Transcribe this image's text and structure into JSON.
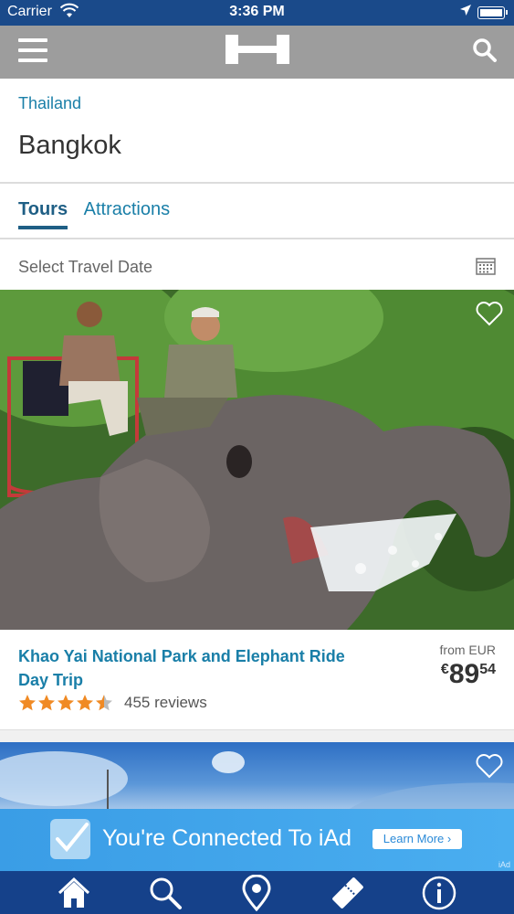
{
  "status_bar": {
    "carrier": "Carrier",
    "time": "3:36 PM"
  },
  "nav": {
    "menu_icon": "hamburger-icon",
    "logo_icon": "hotel-logo-icon",
    "search_icon": "search-icon"
  },
  "header": {
    "breadcrumb": "Thailand",
    "title": "Bangkok"
  },
  "tabs": [
    {
      "label": "Tours",
      "active": true
    },
    {
      "label": "Attractions",
      "active": false
    }
  ],
  "date_filter": {
    "label": "Select Travel Date",
    "icon": "calendar-icon"
  },
  "tours": [
    {
      "title": "Khao Yai National Park and Elephant Ride Day Trip",
      "from_label": "from EUR",
      "currency_symbol": "€",
      "price_whole": "89",
      "price_cents": "54",
      "rating": 4.5,
      "reviews": "455 reviews"
    }
  ],
  "ad": {
    "text": "You're Connected To iAd",
    "button": "Learn More ›",
    "tag": "iAd"
  },
  "bottom_tabs": [
    {
      "icon": "home-icon"
    },
    {
      "icon": "search-icon"
    },
    {
      "icon": "map-pin-icon"
    },
    {
      "icon": "ticket-icon"
    },
    {
      "icon": "info-icon"
    }
  ],
  "colors": {
    "status_bar": "#1a4a8a",
    "nav_bar": "#9d9d9d",
    "link": "#1a7fa8",
    "star": "#f08a24",
    "tab_bar": "#15418a",
    "ad": "#3a9de6"
  }
}
